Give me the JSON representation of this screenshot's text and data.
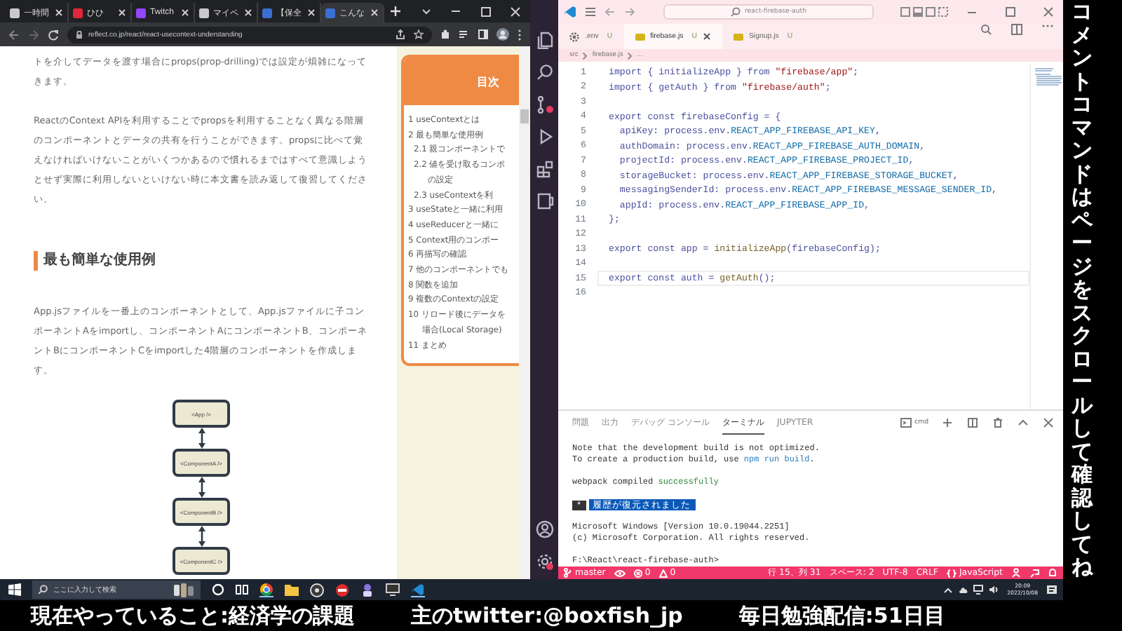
{
  "browser": {
    "tabs": [
      {
        "title": "一時間",
        "color": "#c9c9c9",
        "selected": false
      },
      {
        "title": "ひひ",
        "color": "#e0263a",
        "selected": false
      },
      {
        "title": "Twitch",
        "color": "#9146ff",
        "selected": false
      },
      {
        "title": "マイペ",
        "color": "#c9c9c9",
        "selected": false
      },
      {
        "title": "【保全",
        "color": "#3b6fd1",
        "selected": false
      },
      {
        "title": "こんな",
        "color": "#3b6fd1",
        "selected": true
      }
    ],
    "url": "reflect.co.jp/react/react-usecontext-understanding",
    "article": {
      "intro": [
        "トを介してデータを渡す場合にprops(prop-drilling)では設定が煩雑になってきます。",
        "ReactのContext APIを利用することでpropsを利用することなく異なる階層のコンポーネントとデータの共有を行うことができます。propsに比べて覚えなければいけないことがいくつかあるので慣れるまではすべて意識しようとせず実際に利用しないといけない時に本文書を読み返して復習してください。"
      ],
      "heading": "最も簡単な使用例",
      "body": "App.jsファイルを一番上のコンポーネントとして、App.jsファイルに子コンポーネントAをimportし、コンポーネントAにコンポーネントB、コンポーネントBにコンポーネントCをimportした4階層のコンポーネントを作成します。",
      "diagram": [
        "<App />",
        "<ComponentA />",
        "<ComponentB />",
        "<ComponentC />"
      ]
    },
    "toc": {
      "title": "目次",
      "items": [
        {
          "lines": [
            "1 useContextとは"
          ]
        },
        {
          "lines": [
            "2 最も簡単な使用例"
          ],
          "children": [
            {
              "lines": [
                "2.1 親コンポーネントで"
              ]
            },
            {
              "lines": [
                "2.2 値を受け取るコンポ",
                "の設定"
              ]
            },
            {
              "lines": [
                "2.3 useContextを利"
              ]
            }
          ]
        },
        {
          "lines": [
            "3 useStateと一緒に利用"
          ]
        },
        {
          "lines": [
            "4 useReducerと一緒に"
          ]
        },
        {
          "lines": [
            "5 Context用のコンポー"
          ]
        },
        {
          "lines": [
            "6 再描写の確認"
          ]
        },
        {
          "lines": [
            "7 他のコンポーネントでも"
          ]
        },
        {
          "lines": [
            "8 関数を追加"
          ]
        },
        {
          "lines": [
            "9 複数のContextの設定"
          ]
        },
        {
          "lines": [
            "10 リロード後にデータを",
            "場合(Local Storage)"
          ]
        },
        {
          "lines": [
            "11 まとめ"
          ]
        }
      ]
    }
  },
  "editor": {
    "search": "react-firebase-auth",
    "tabs": [
      {
        "label": ".env",
        "badge": "U",
        "kind": "config",
        "selected": false
      },
      {
        "label": "firebase.js",
        "badge": "U",
        "kind": "js",
        "selected": true
      },
      {
        "label": "Signup.js",
        "badge": "U",
        "kind": "js",
        "selected": false
      }
    ],
    "breadcrumb": [
      "src",
      "firebase.js",
      "..."
    ],
    "code": [
      {
        "number": "1",
        "current": false,
        "text": "import { initializeApp } from \"firebase/app\";"
      },
      {
        "number": "2",
        "current": false,
        "text": "import { getAuth } from \"firebase/auth\";"
      },
      {
        "number": "3",
        "current": false
      },
      {
        "number": "4",
        "current": false,
        "text": "export const firebaseConfig = {"
      },
      {
        "number": "5",
        "current": false,
        "text": "  apiKey: process.env.REACT_APP_FIREBASE_API_KEY,"
      },
      {
        "number": "6",
        "current": false,
        "text": "  authDomain: process.env.REACT_APP_FIREBASE_AUTH_DOMAIN,"
      },
      {
        "number": "7",
        "current": false,
        "text": "  projectId: process.env.REACT_APP_FIREBASE_PROJECT_ID,"
      },
      {
        "number": "8",
        "current": false,
        "text": "  storageBucket: process.env.REACT_APP_FIREBASE_STORAGE_BUCKET,"
      },
      {
        "number": "9",
        "current": false,
        "text": "  messagingSenderId: process.env.REACT_APP_FIREBASE_MESSAGE_SENDER_ID,"
      },
      {
        "number": "10",
        "current": false,
        "text": "  appId: process.env.REACT_APP_FIREBASE_APP_ID,"
      },
      {
        "number": "11",
        "current": false,
        "text": "};"
      },
      {
        "number": "12",
        "current": false
      },
      {
        "number": "13",
        "current": false,
        "text": "export const app = initializeApp(firebaseConfig);"
      },
      {
        "number": "14",
        "current": false
      },
      {
        "number": "15",
        "current": true,
        "text": "export const auth = getAuth();"
      },
      {
        "number": "16",
        "current": false
      }
    ],
    "panel": {
      "tabs": [
        {
          "label": "問題",
          "selected": false
        },
        {
          "label": "出力",
          "selected": false
        },
        {
          "label": "デバッグ コンソール",
          "selected": false
        },
        {
          "label": "ターミナル",
          "selected": true
        },
        {
          "label": "JUPYTER",
          "selected": false
        }
      ],
      "shell": "cmd",
      "terminal": [
        {
          "kind": "plain",
          "text": "Note that the development build is not optimized."
        },
        {
          "kind": "link",
          "before": "To create a production build, use",
          "link": "npm run build",
          "after": "."
        },
        {
          "kind": "blank"
        },
        {
          "kind": "success",
          "before": "webpack compiled",
          "status": "successfully"
        },
        {
          "kind": "blank"
        },
        {
          "kind": "banner",
          "mark": "*",
          "text": "履歴が復元されました"
        },
        {
          "kind": "blank"
        },
        {
          "kind": "plain",
          "text": "Microsoft Windows [Version 10.0.19044.2251]"
        },
        {
          "kind": "plain",
          "text": "(c) Microsoft Corporation. All rights reserved."
        },
        {
          "kind": "blank"
        },
        {
          "kind": "plain",
          "text": "F:\\React\\react-firebase-auth>"
        }
      ]
    },
    "status_bar": {
      "branch": "master",
      "errors": "0",
      "warnings": "0",
      "position": "行 15、列 31",
      "indent": "スペース: 2",
      "encoding": "UTF-8",
      "eol": "CRLF",
      "language": "JavaScript"
    }
  },
  "taskbar": {
    "search_placeholder": "ここに入力して検索",
    "time": "20:09",
    "date": "2022/10/08"
  },
  "overlay": {
    "side_text": "コメントコマンドはページをスクロールして確認してね",
    "captions": [
      "現在やっていること:経済学の課題",
      "主のtwitter:@boxfish_jp",
      "毎日勉強配信:51日目"
    ]
  }
}
